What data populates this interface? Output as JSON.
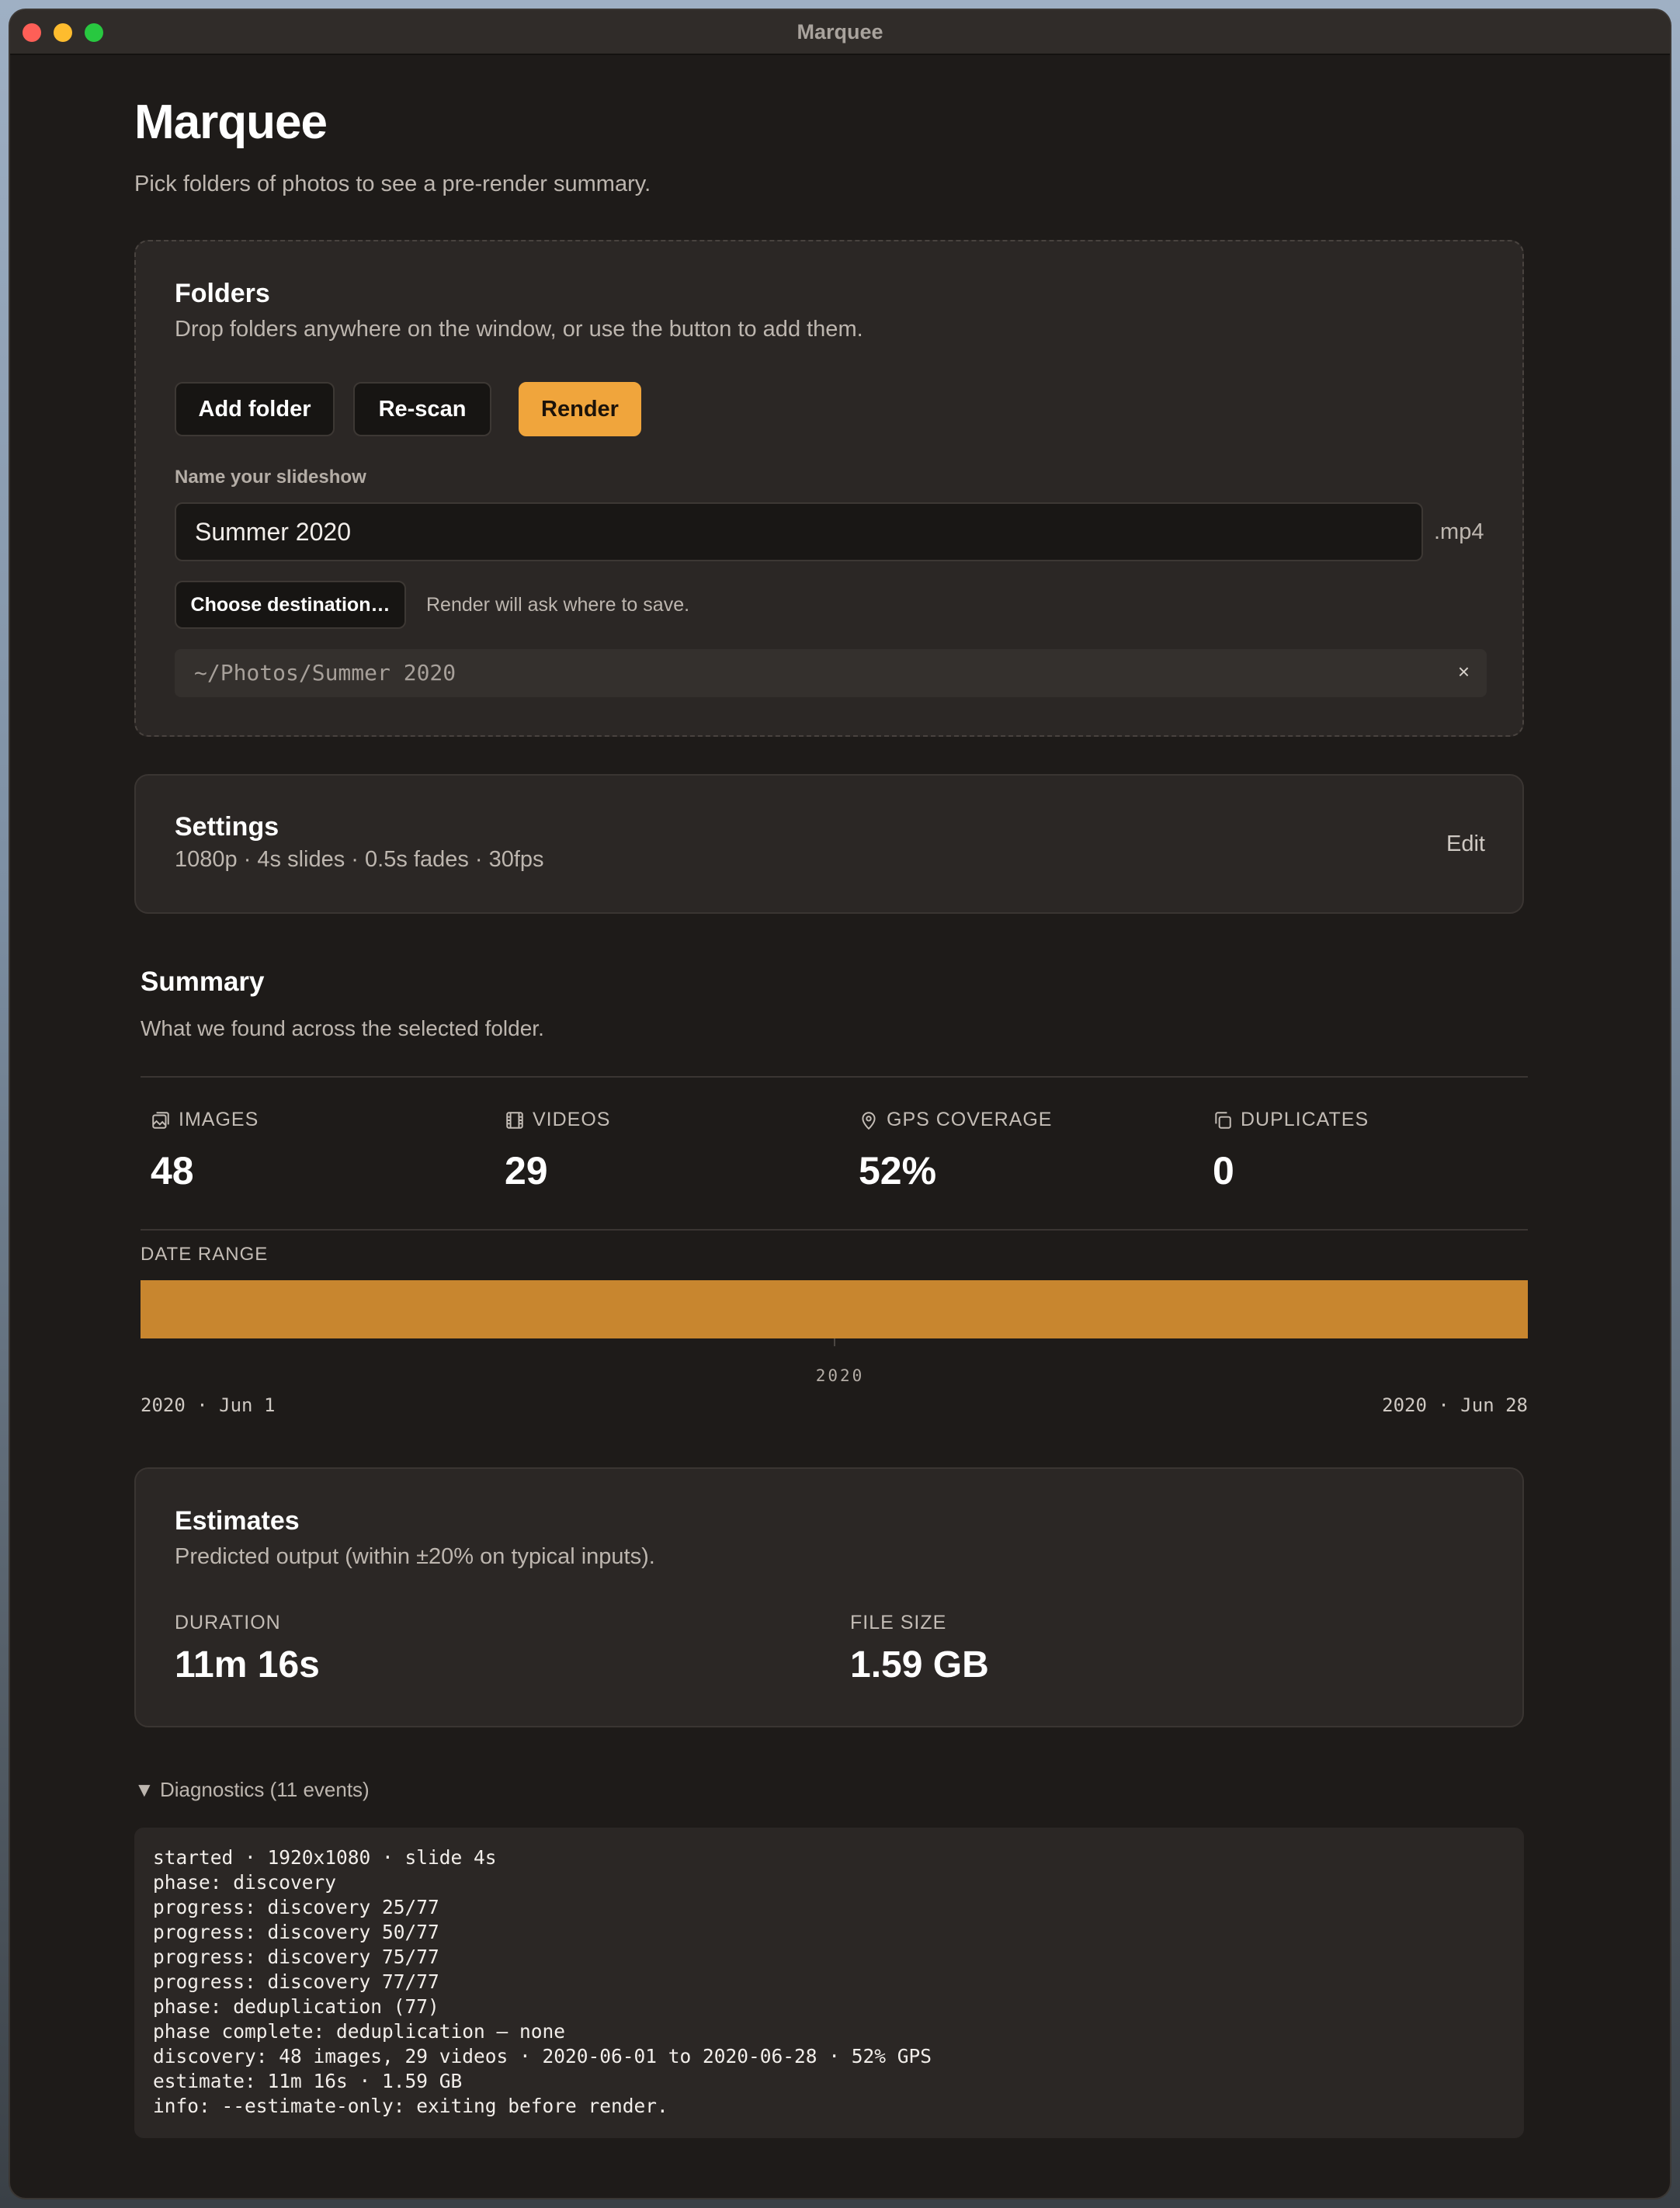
{
  "window": {
    "title": "Marquee"
  },
  "header": {
    "title": "Marquee",
    "subtitle": "Pick folders of photos to see a pre-render summary."
  },
  "folders": {
    "title": "Folders",
    "subtitle": "Drop folders anywhere on the window, or use the button to add them.",
    "add_label": "Add folder",
    "rescan_label": "Re-scan",
    "render_label": "Render",
    "name_label": "Name your slideshow",
    "name_value": "Summer 2020",
    "extension": ".mp4",
    "destination_label": "Choose destination…",
    "destination_note": "Render will ask where to save.",
    "folder_path": "~/Photos/Summer 2020",
    "remove_glyph": "×"
  },
  "settings": {
    "title": "Settings",
    "summary": "1080p · 4s slides · 0.5s fades · 30fps",
    "edit_label": "Edit"
  },
  "summary": {
    "title": "Summary",
    "subtitle": "What we found across the selected folder.",
    "stats": [
      {
        "label": "IMAGES",
        "value": "48",
        "icon": "images-icon"
      },
      {
        "label": "VIDEOS",
        "value": "29",
        "icon": "film-icon"
      },
      {
        "label": "GPS COVERAGE",
        "value": "52%",
        "icon": "map-pin-icon"
      },
      {
        "label": "DUPLICATES",
        "value": "0",
        "icon": "copy-icon"
      }
    ],
    "date_range": {
      "label": "DATE RANGE",
      "year": "2020",
      "start": "2020 · Jun 1",
      "end": "2020 · Jun 28",
      "bar_color": "#c8862f"
    }
  },
  "estimates": {
    "title": "Estimates",
    "subtitle": "Predicted output (within ±20% on typical inputs).",
    "duration_label": "DURATION",
    "duration_value": "11m 16s",
    "size_label": "FILE SIZE",
    "size_value": "1.59 GB"
  },
  "diagnostics": {
    "toggle": "▼ Diagnostics (11 events)",
    "lines": [
      "started · 1920x1080 · slide 4s",
      "phase: discovery",
      "progress: discovery 25/77",
      "progress: discovery 50/77",
      "progress: discovery 75/77",
      "progress: discovery 77/77",
      "phase: deduplication (77)",
      "phase complete: deduplication — none",
      "discovery: 48 images, 29 videos · 2020-06-01 to 2020-06-28 · 52% GPS",
      "estimate: 11m 16s · 1.59 GB",
      "info: --estimate-only: exiting before render."
    ]
  },
  "colors": {
    "accent": "#f0a53c",
    "background": "#1e1b19",
    "card": "#2b2725"
  }
}
